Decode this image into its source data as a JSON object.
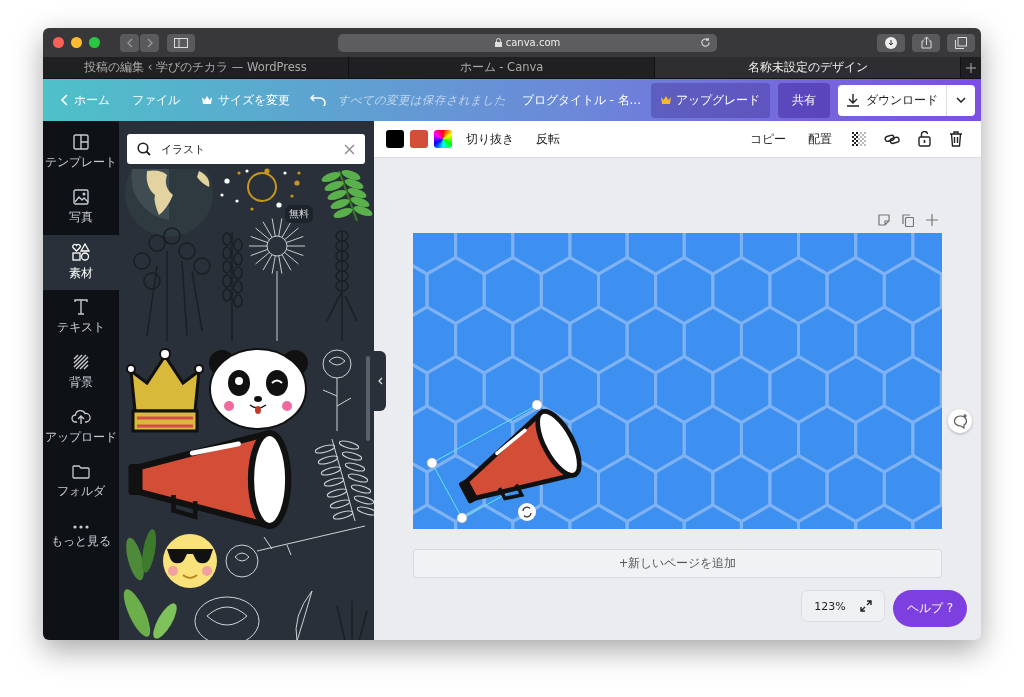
{
  "browser": {
    "url": "canva.com",
    "tabs": [
      {
        "label": "投稿の編集 ‹ 学びのチカラ — WordPress",
        "selected": false
      },
      {
        "label": "ホーム - Canva",
        "selected": false
      },
      {
        "label": "名称未設定のデザイン",
        "selected": true
      }
    ]
  },
  "header": {
    "home": "ホーム",
    "file": "ファイル",
    "resize": "サイズを変更",
    "saved_status": "すべての変更は保存されました",
    "title": "ブログタイトル - 名...",
    "upgrade": "アップグレード",
    "share": "共有",
    "download": "ダウンロード"
  },
  "rail": {
    "items": [
      {
        "label": "テンプレート",
        "kind": "template",
        "selected": false
      },
      {
        "label": "写真",
        "kind": "photo",
        "selected": false
      },
      {
        "label": "素材",
        "kind": "elements",
        "selected": true
      },
      {
        "label": "テキスト",
        "kind": "text",
        "selected": false
      },
      {
        "label": "背景",
        "kind": "background",
        "selected": false
      },
      {
        "label": "アップロード",
        "kind": "upload",
        "selected": false
      },
      {
        "label": "フォルダ",
        "kind": "folder",
        "selected": false
      },
      {
        "label": "もっと見る",
        "kind": "more",
        "selected": false
      }
    ]
  },
  "panel": {
    "search": {
      "value": "イラスト"
    },
    "badge": "無料"
  },
  "toolbar": {
    "swatches": [
      {
        "kind": "solid",
        "color": "#000000"
      },
      {
        "kind": "solid",
        "color": "#d44d36"
      },
      {
        "kind": "gradient"
      }
    ],
    "left_actions": [
      "切り抜き",
      "反転"
    ],
    "right_actions": [
      "コピー",
      "配置"
    ]
  },
  "editor": {
    "add_page": "+新しいページを追加",
    "zoom": "123%",
    "help": "ヘルプ ?"
  }
}
